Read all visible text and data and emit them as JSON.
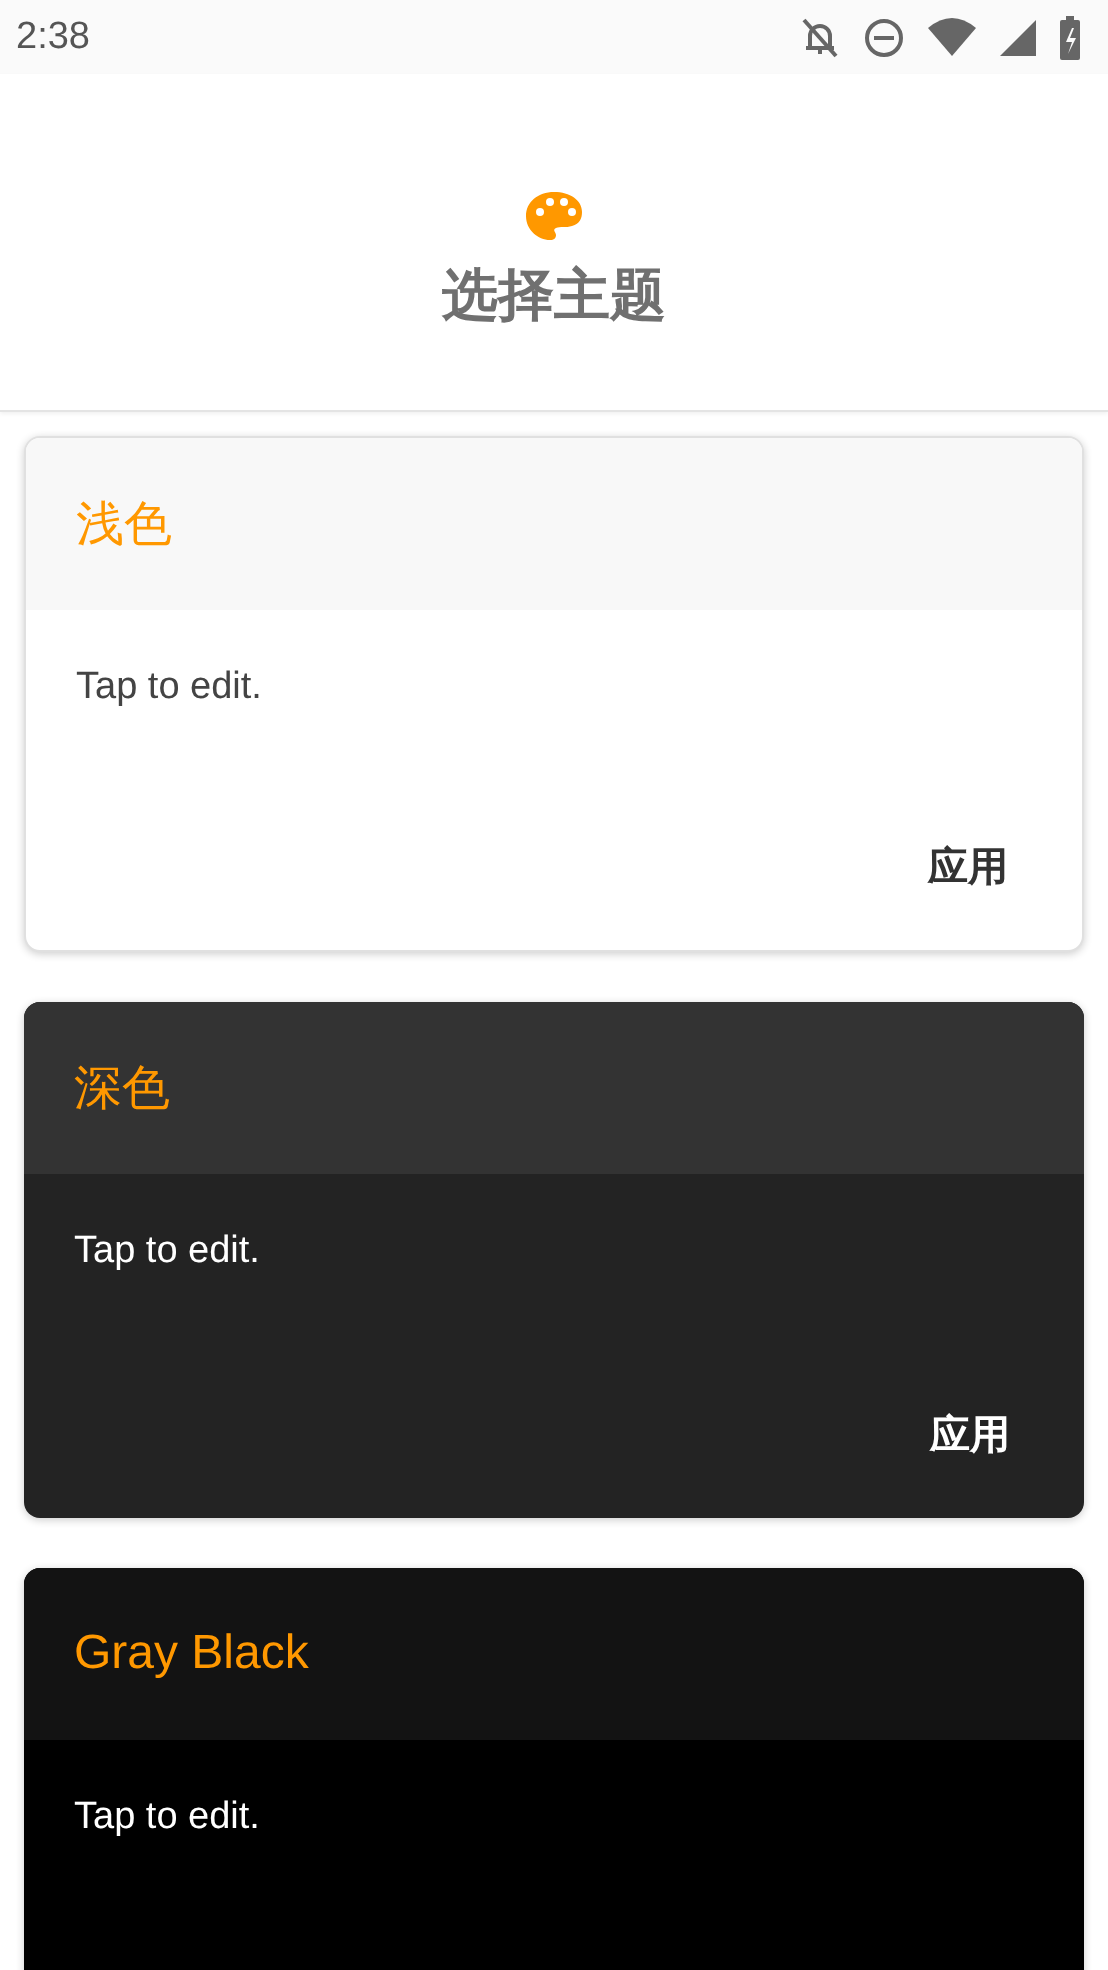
{
  "status_bar": {
    "time": "2:38"
  },
  "header": {
    "title": "选择主题"
  },
  "themes": [
    {
      "kind": "light",
      "name": "浅色",
      "body": "Tap to edit.",
      "button": "应用"
    },
    {
      "kind": "dark",
      "name": "深色",
      "body": "Tap to edit.",
      "button": "应用"
    },
    {
      "kind": "black",
      "name": "Gray Black",
      "body": "Tap to edit."
    }
  ]
}
